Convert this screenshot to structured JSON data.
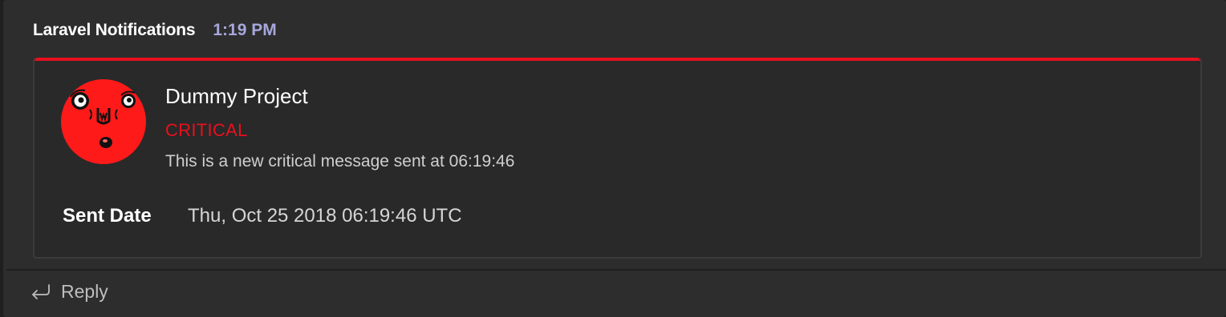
{
  "message": {
    "sender": "Laravel Notifications",
    "time": "1:19 PM"
  },
  "card": {
    "accent_color": "#e8101e",
    "avatar_icon": "red-face-avatar-icon",
    "title": "Dummy Project",
    "severity": "CRITICAL",
    "severity_color": "#e8101e",
    "text": "This is a new critical message sent at 06:19:46",
    "facts": [
      {
        "name": "Sent Date",
        "value": "Thu, Oct 25 2018 06:19:46 UTC"
      }
    ]
  },
  "actions": {
    "reply_icon": "reply-arrow-icon",
    "reply_label": "Reply"
  }
}
